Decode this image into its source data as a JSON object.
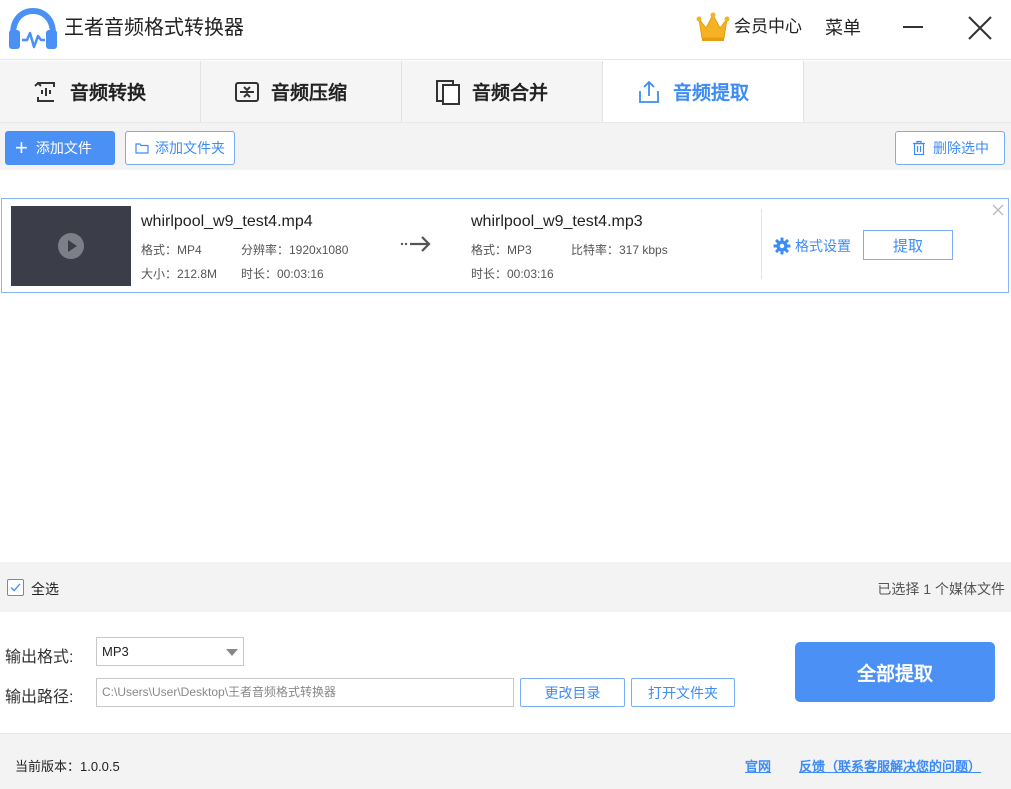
{
  "app": {
    "title": "王者音频格式转换器",
    "vip_label": "会员中心",
    "menu_label": "菜单"
  },
  "tabs": [
    {
      "label": "音频转换",
      "icon": "audio-convert-icon"
    },
    {
      "label": "音频压缩",
      "icon": "compress-icon"
    },
    {
      "label": "音频合并",
      "icon": "merge-icon"
    },
    {
      "label": "音频提取",
      "icon": "extract-icon",
      "active": true
    }
  ],
  "toolbar": {
    "add_file": "添加文件",
    "add_folder": "添加文件夹",
    "delete_selected": "删除选中"
  },
  "file": {
    "source_name": "whirlpool_w9_test4.mp4",
    "source_format": "格式：MP4",
    "source_resolution": "分辨率：1920x1080",
    "source_size": "大小：212.8M",
    "source_duration": "时长：00:03:16",
    "target_name": "whirlpool_w9_test4.mp3",
    "target_format": "格式：MP3",
    "target_bitrate": "比特率：317 kbps",
    "target_duration": "时长：00:03:16",
    "format_settings": "格式设置",
    "extract_label": "提取"
  },
  "selection": {
    "select_all": "全选",
    "checked": true,
    "count_text": "已选择 1 个媒体文件"
  },
  "output": {
    "format_label": "输出格式:",
    "format_value": "MP3",
    "path_label": "输出路径:",
    "path_value": "C:\\Users\\User\\Desktop\\王者音频格式转换器",
    "change_dir": "更改目录",
    "open_folder": "打开文件夹",
    "extract_all": "全部提取"
  },
  "footer": {
    "version": "当前版本：1.0.0.5",
    "website": "官网",
    "feedback": "反馈（联系客服解决您的问题）"
  },
  "colors": {
    "accent": "#4a90f5",
    "accent_text": "#3d8cf6",
    "bar_bg": "#f3f3f3"
  }
}
